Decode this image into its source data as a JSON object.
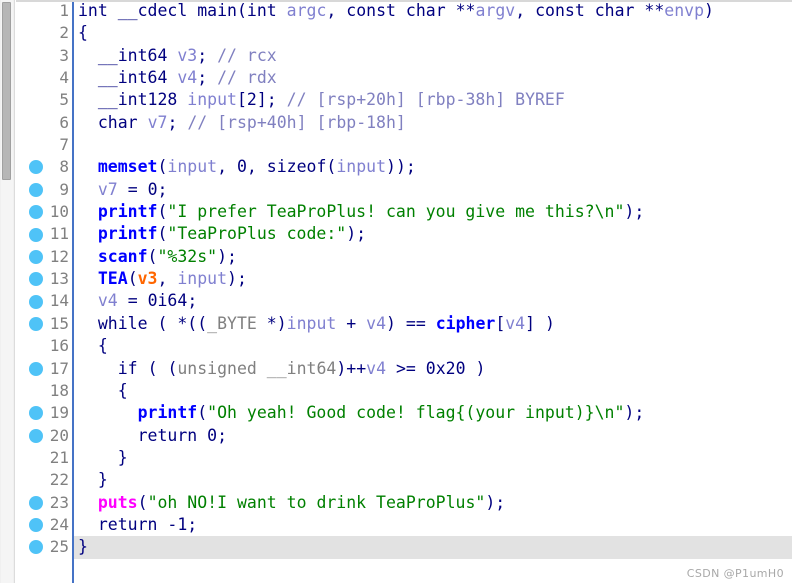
{
  "app": {
    "title": "IDA Pseudocode",
    "watermark": "CSDN @P1umH0",
    "accent_color": "#4573c6",
    "breakpoint_color": "#4fc3f7",
    "current_line_bg": "#e2e2e2",
    "scrollbar_thumb_color": "#b6b6b6"
  },
  "editor": {
    "total_lines": 25,
    "current_line": 25,
    "breakpoint_lines": [
      8,
      9,
      10,
      11,
      12,
      13,
      14,
      15,
      17,
      19,
      20,
      23,
      24,
      25
    ],
    "line_numbers": [
      "1",
      "2",
      "3",
      "4",
      "5",
      "6",
      "7",
      "8",
      "9",
      "10",
      "11",
      "12",
      "13",
      "14",
      "15",
      "16",
      "17",
      "18",
      "19",
      "20",
      "21",
      "22",
      "23",
      "24",
      "25"
    ],
    "lines": [
      {
        "n": 1,
        "text": "int __cdecl main(int argc, const char **argv, const char **envp)"
      },
      {
        "n": 2,
        "text": "{"
      },
      {
        "n": 3,
        "text": "  __int64 v3; // rcx"
      },
      {
        "n": 4,
        "text": "  __int64 v4; // rdx"
      },
      {
        "n": 5,
        "text": "  __int128 input[2]; // [rsp+20h] [rbp-38h] BYREF"
      },
      {
        "n": 6,
        "text": "  char v7; // [rsp+40h] [rbp-18h]"
      },
      {
        "n": 7,
        "text": ""
      },
      {
        "n": 8,
        "text": "  memset(input, 0, sizeof(input));"
      },
      {
        "n": 9,
        "text": "  v7 = 0;"
      },
      {
        "n": 10,
        "text": "  printf(\"I prefer TeaProPlus! can you give me this?\\n\");"
      },
      {
        "n": 11,
        "text": "  printf(\"TeaProPlus code:\");"
      },
      {
        "n": 12,
        "text": "  scanf(\"%32s\");"
      },
      {
        "n": 13,
        "text": "  TEA(v3, input);"
      },
      {
        "n": 14,
        "text": "  v4 = 0i64;"
      },
      {
        "n": 15,
        "text": "  while ( *((_BYTE *)input + v4) == cipher[v4] )"
      },
      {
        "n": 16,
        "text": "  {"
      },
      {
        "n": 17,
        "text": "    if ( (unsigned __int64)++v4 >= 0x20 )"
      },
      {
        "n": 18,
        "text": "    {"
      },
      {
        "n": 19,
        "text": "      printf(\"Oh yeah! Good code! flag{(your input)}\\n\");"
      },
      {
        "n": 20,
        "text": "      return 0;"
      },
      {
        "n": 21,
        "text": "    }"
      },
      {
        "n": 22,
        "text": "  }"
      },
      {
        "n": 23,
        "text": "  puts(\"oh NO!I want to drink TeaProPlus\");"
      },
      {
        "n": 24,
        "text": "  return -1;"
      },
      {
        "n": 25,
        "text": "}"
      }
    ]
  },
  "code_identifiers": {
    "function_name": "main",
    "calling_convention": "__cdecl",
    "return_type": "int",
    "parameters": [
      "int argc",
      "const char **argv",
      "const char **envp"
    ],
    "locals": [
      {
        "decl": "__int64 v3;",
        "comment": "// rcx"
      },
      {
        "decl": "__int64 v4;",
        "comment": "// rdx"
      },
      {
        "decl": "__int128 input[2];",
        "comment": "// [rsp+20h] [rbp-38h] BYREF"
      },
      {
        "decl": "char v7;",
        "comment": "// [rsp+40h] [rbp-18h]"
      }
    ],
    "called_functions": [
      "memset",
      "printf",
      "scanf",
      "TEA",
      "puts"
    ],
    "highlighted_symbol": "puts",
    "string_literals": [
      "I prefer TeaProPlus! can you give me this?\\n",
      "TeaProPlus code:",
      "%32s",
      "Oh yeah! Good code! flag{(your input)}\\n",
      "oh NO!I want to drink TeaProPlus"
    ],
    "constants": [
      "0",
      "0i64",
      "0x20",
      "-1"
    ],
    "global_array": "cipher"
  }
}
